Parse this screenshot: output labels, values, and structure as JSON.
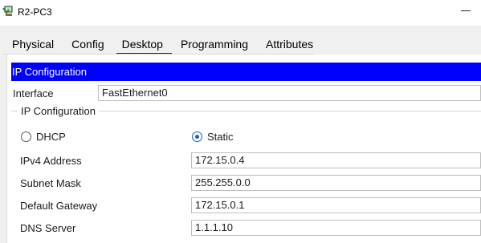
{
  "window": {
    "title": "R2-PC3",
    "icon": "pc-device-icon"
  },
  "tabs": [
    {
      "label": "Physical",
      "active": false
    },
    {
      "label": "Config",
      "active": false
    },
    {
      "label": "Desktop",
      "active": true
    },
    {
      "label": "Programming",
      "active": false
    },
    {
      "label": "Attributes",
      "active": false
    }
  ],
  "panel": {
    "header": "IP Configuration",
    "interface_label": "Interface",
    "interface_value": "FastEthernet0",
    "group_label": "IP Configuration",
    "dhcp_label": "DHCP",
    "static_label": "Static",
    "selected_mode": "Static",
    "accent_color": "#0000ff",
    "fields": [
      {
        "label": "IPv4 Address",
        "value": "172.15.0.4"
      },
      {
        "label": "Subnet Mask",
        "value": "255.255.0.0"
      },
      {
        "label": "Default Gateway",
        "value": "172.15.0.1"
      },
      {
        "label": "DNS Server",
        "value": "1.1.1.10"
      }
    ]
  }
}
